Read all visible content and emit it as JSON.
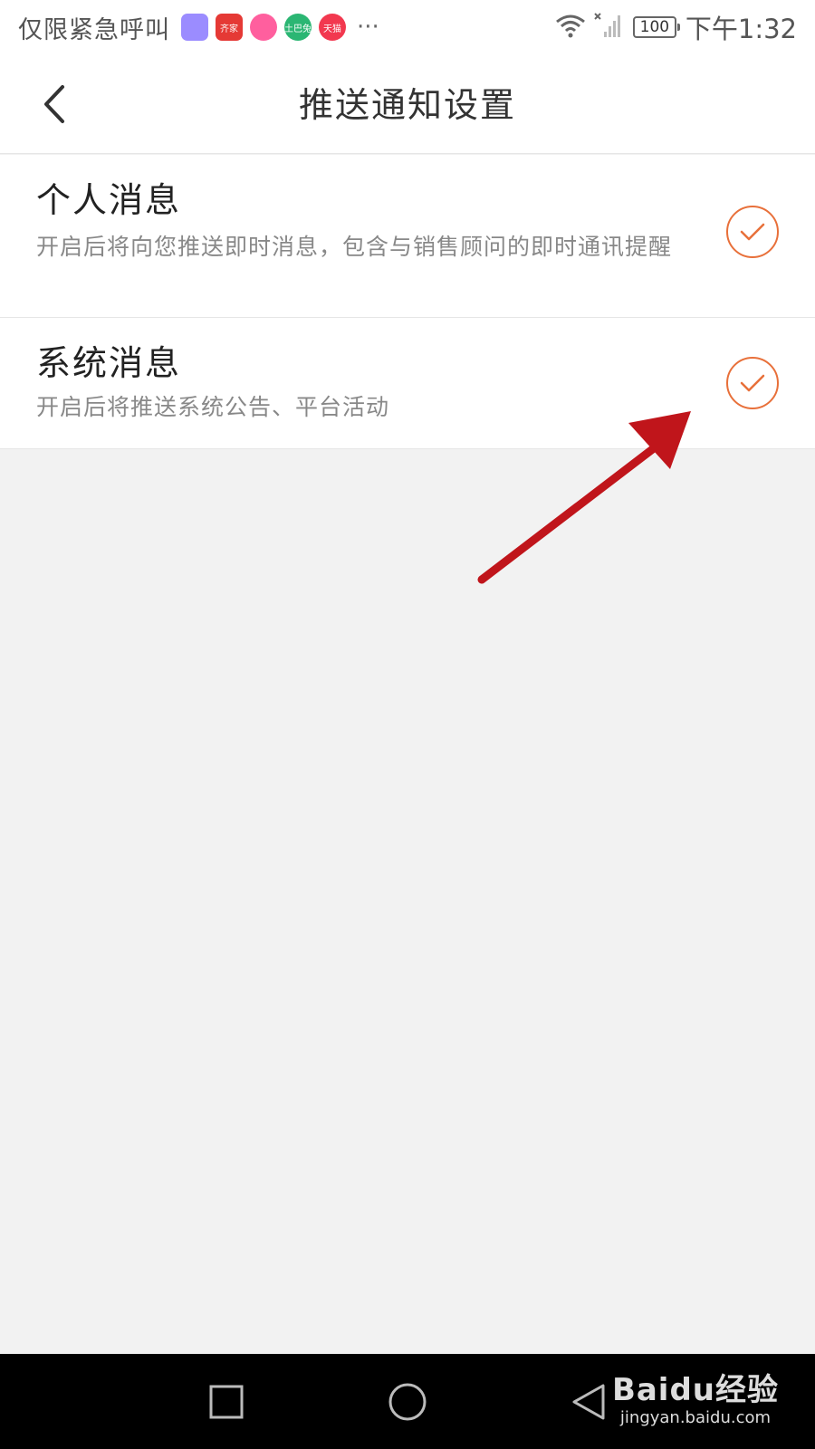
{
  "status_bar": {
    "carrier": "仅限紧急呼叫",
    "app_icons": [
      {
        "name": "gift-app-icon",
        "color": "#9b8cff",
        "label": ""
      },
      {
        "name": "qijia-app-icon",
        "color": "#e53935",
        "label": "齐家"
      },
      {
        "name": "pink-app-icon",
        "color": "#ff5f9e",
        "label": ""
      },
      {
        "name": "tudou-app-icon",
        "color": "#2bb673",
        "label": "土巴兔"
      },
      {
        "name": "tmall-app-icon",
        "color": "#f2384f",
        "label": "天猫"
      }
    ],
    "more": "···",
    "battery": "100",
    "time": "下午1:32"
  },
  "header": {
    "title": "推送通知设置"
  },
  "settings": [
    {
      "title": "个人消息",
      "description": "开启后将向您推送即时消息，包含与销售顾问的即时通讯提醒",
      "checked": true
    },
    {
      "title": "系统消息",
      "description": "开启后将推送系统公告、平台活动",
      "checked": true
    }
  ],
  "watermark": {
    "brand": "Baidu经验",
    "url": "jingyan.baidu.com"
  },
  "colors": {
    "accent": "#e8703a",
    "annotation_arrow": "#c0151b"
  }
}
